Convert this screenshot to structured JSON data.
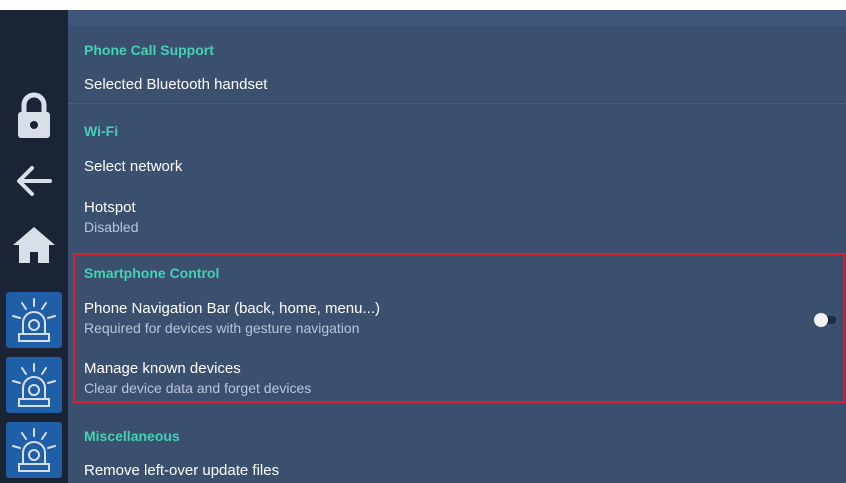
{
  "sidebar": {
    "icons": [
      "lock-icon",
      "back-arrow-icon",
      "home-icon",
      "alarm-icon",
      "alarm-icon",
      "alarm-icon"
    ]
  },
  "sections": {
    "phone_call": {
      "header": "Phone Call Support",
      "items": [
        {
          "title": "Selected Bluetooth handset"
        }
      ]
    },
    "wifi": {
      "header": "Wi-Fi",
      "items": [
        {
          "title": "Select network"
        },
        {
          "title": "Hotspot",
          "subtitle": "Disabled"
        }
      ]
    },
    "smartphone": {
      "header": "Smartphone Control",
      "items": [
        {
          "title": "Phone Navigation Bar (back, home, menu...)",
          "subtitle": "Required for devices with gesture navigation",
          "toggle": false
        },
        {
          "title": "Manage known devices",
          "subtitle": "Clear device data and forget devices"
        }
      ]
    },
    "misc": {
      "header": "Miscellaneous",
      "items": [
        {
          "title": "Remove left-over update files"
        }
      ]
    }
  },
  "colors": {
    "background": "#3b4f6e",
    "sidebar": "#1b2434",
    "accent": "#43d3b4",
    "highlight_border": "#d8212f",
    "alarm_button": "#1f5fa8"
  }
}
